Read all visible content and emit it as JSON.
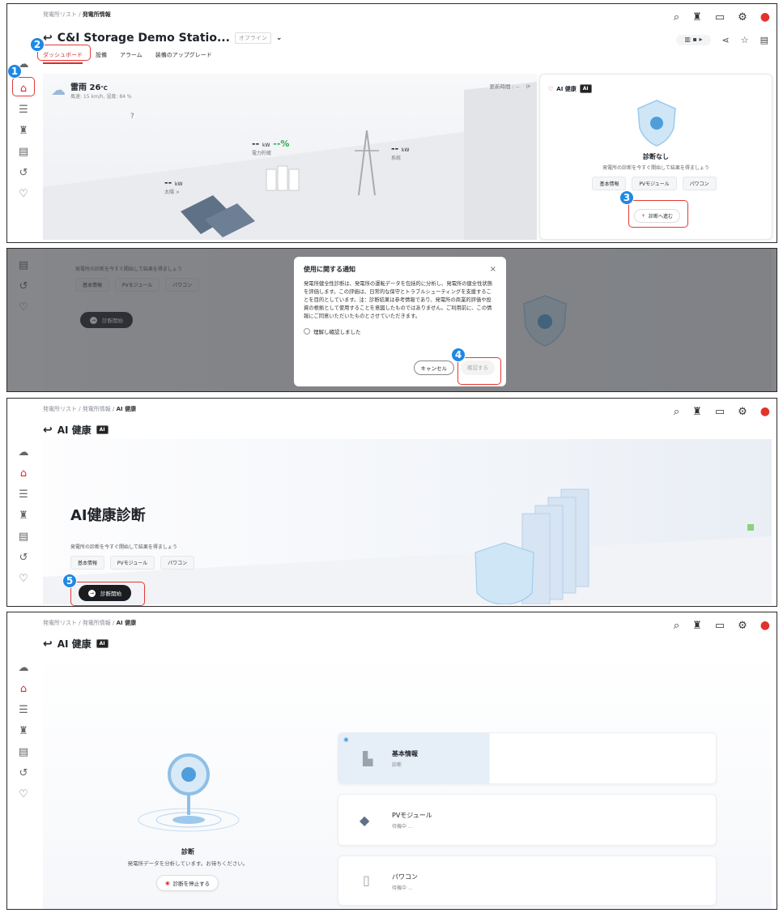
{
  "breadcrumb": {
    "p1": [
      "発電所リスト",
      "発電所情報"
    ],
    "p3": [
      "発電所リスト",
      "発電所情報",
      "AI 健康"
    ]
  },
  "station": {
    "title": "C&I Storage Demo Statio...",
    "status": "オフライン"
  },
  "tabs": [
    "ダッシュボード",
    "設備",
    "アラーム",
    "装備のアップグレード"
  ],
  "weather": {
    "label": "雷雨",
    "temp": "26",
    "unit": "℃",
    "detail": "風速: 15 km/h, 湿度: 84 %"
  },
  "update_time": "更新時間 : --",
  "energy": {
    "storage": {
      "value": "--",
      "unit": "kW",
      "pct": "--%",
      "label": "電力貯蔵"
    },
    "grid": {
      "value": "--",
      "unit": "kW",
      "label": "系統"
    },
    "solar": {
      "value": "--",
      "unit": "kW",
      "label": "太陽 >"
    }
  },
  "ai_card": {
    "title": "AI 健康",
    "ai": "AI",
    "status": "診断なし",
    "desc": "発電所の診断を今すぐ開始して結果を得ましょう",
    "chips": [
      "基本情報",
      "PVモジュール",
      "パワコン"
    ],
    "cta": "診断へ進む"
  },
  "dialog": {
    "title": "使用に関する通知",
    "body": "発電所健全性診断は、発電所の運転データを包括的に分析し、発電所の健全性状態を評価します。この評価は、日常的な保守とトラブルシューティングを支援することを目的としています。注：診断結果は参考情報であり、発電所の商業的評価や投資の根拠として使用することを意図したものではありません。ご利用前に、この情報にご同意いただいたものとさせていただきます。",
    "checkbox": "理解し確認しました",
    "cancel": "キャンセル",
    "confirm": "確認する"
  },
  "diag": {
    "page_title": "AI 健康",
    "hero_title": "AI健康診断",
    "desc": "発電所の診断を今すぐ開始して結果を得ましょう",
    "start": "診断開始"
  },
  "progress": {
    "title": "診断",
    "subtitle": "発電所データを分析しています。お待ちください。",
    "stop": "診断を停止する",
    "items": [
      {
        "name": "基本情報",
        "state": "診断"
      },
      {
        "name": "PVモジュール",
        "state": "待機中 ..."
      },
      {
        "name": "パワコン",
        "state": "待機中 ..."
      }
    ]
  },
  "callouts": [
    "1",
    "2",
    "3",
    "4",
    "5"
  ],
  "colors": {
    "accent": "#d72c2c",
    "callout": "#1e88e5",
    "highlight": "#e53935"
  }
}
